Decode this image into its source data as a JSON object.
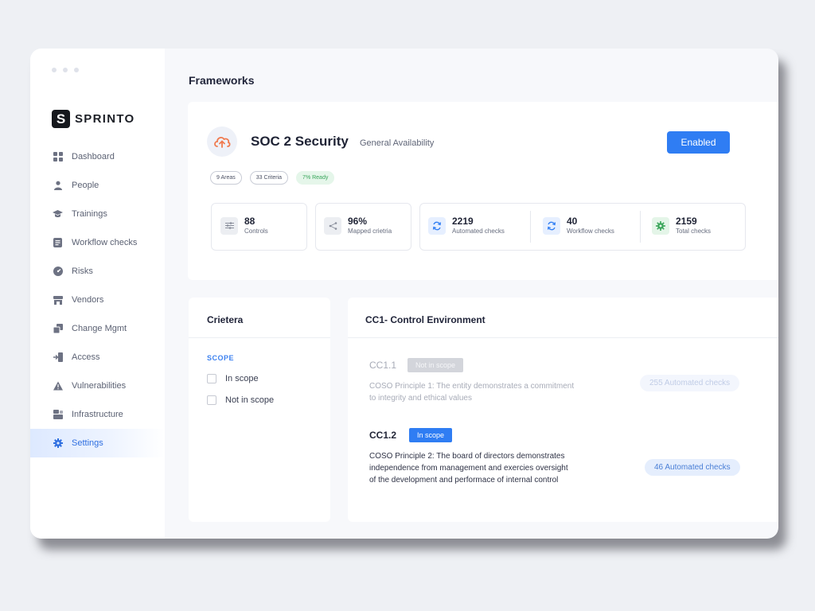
{
  "sidebar": {
    "logo_mark": "S",
    "logo_text": "SPRINTO",
    "items": [
      {
        "label": "Dashboard",
        "icon": "dashboard-icon"
      },
      {
        "label": "People",
        "icon": "person-icon"
      },
      {
        "label": "Trainings",
        "icon": "graduation-cap-icon"
      },
      {
        "label": "Workflow checks",
        "icon": "document-icon"
      },
      {
        "label": "Risks",
        "icon": "gauge-icon"
      },
      {
        "label": "Vendors",
        "icon": "store-icon"
      },
      {
        "label": "Change Mgmt",
        "icon": "copy-icon"
      },
      {
        "label": "Access",
        "icon": "login-icon"
      },
      {
        "label": "Vulnerabilities",
        "icon": "warning-icon"
      },
      {
        "label": "Infrastructure",
        "icon": "server-icon"
      },
      {
        "label": "Settings",
        "icon": "gear-icon",
        "active": true
      }
    ]
  },
  "main": {
    "title": "Frameworks"
  },
  "framework": {
    "name": "SOC 2 Security",
    "status_text": "General Availability",
    "enabled_label": "Enabled",
    "pills": [
      "9 Areas",
      "33 Criteria",
      "7% Ready"
    ],
    "stats": [
      {
        "value": "88",
        "label": "Controls",
        "icon": "sliders-icon"
      },
      {
        "value": "96%",
        "label": "Mapped crietria",
        "icon": "share-icon"
      },
      {
        "value": "2219",
        "label": "Automated checks",
        "icon": "sync-icon"
      },
      {
        "value": "40",
        "label": "Workflow checks",
        "icon": "sync-icon"
      },
      {
        "value": "2159",
        "label": "Total checks",
        "icon": "gear-icon"
      }
    ]
  },
  "criteria": {
    "title": "Crietera",
    "scope_label": "SCOPE",
    "options": [
      "In scope",
      "Not in scope"
    ]
  },
  "control": {
    "title": "CC1- Control Environment",
    "items": [
      {
        "code": "CC1.1",
        "badge": "Not in scope",
        "desc_lines": [
          "COSO Principle 1: The entity demonstrates a commitment",
          "to integrity and ethical values"
        ],
        "checks": "255 Automated checks",
        "in_scope": false
      },
      {
        "code": "CC1.2",
        "badge": "In scope",
        "desc_lines": [
          "COSO Principle 2: The board of directors demonstrates",
          "independence from management and exercies oversight",
          "of the development and performace of internal control"
        ],
        "checks": "46 Automated checks",
        "in_scope": true
      }
    ]
  },
  "colors": {
    "accent": "#2f7df3",
    "ready_green": "#39a65b",
    "active_nav_bg": "#dde9ff"
  }
}
